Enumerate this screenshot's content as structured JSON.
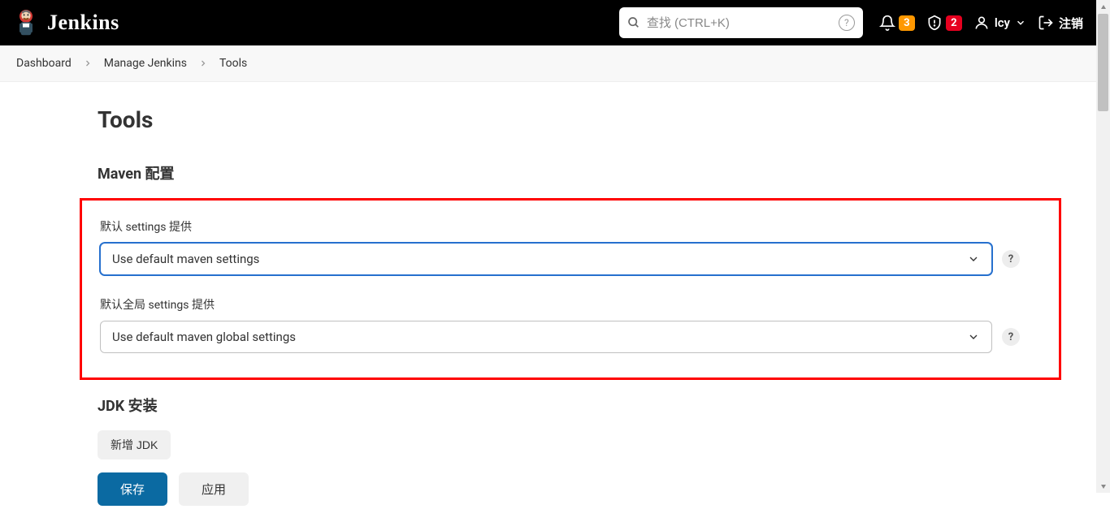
{
  "header": {
    "brand": "Jenkins",
    "search_placeholder": "查找 (CTRL+K)",
    "notif_count": "3",
    "alert_count": "2",
    "username": "lcy",
    "logout": "注销"
  },
  "breadcrumb": {
    "items": [
      "Dashboard",
      "Manage Jenkins",
      "Tools"
    ]
  },
  "main": {
    "title": "Tools",
    "section_maven": "Maven 配置",
    "field1_label": "默认 settings 提供",
    "field1_value": "Use default maven settings",
    "field2_label": "默认全局 settings 提供",
    "field2_value": "Use default maven global settings",
    "section_jdk": "JDK 安装",
    "add_jdk": "新增 JDK",
    "save": "保存",
    "apply": "应用"
  }
}
